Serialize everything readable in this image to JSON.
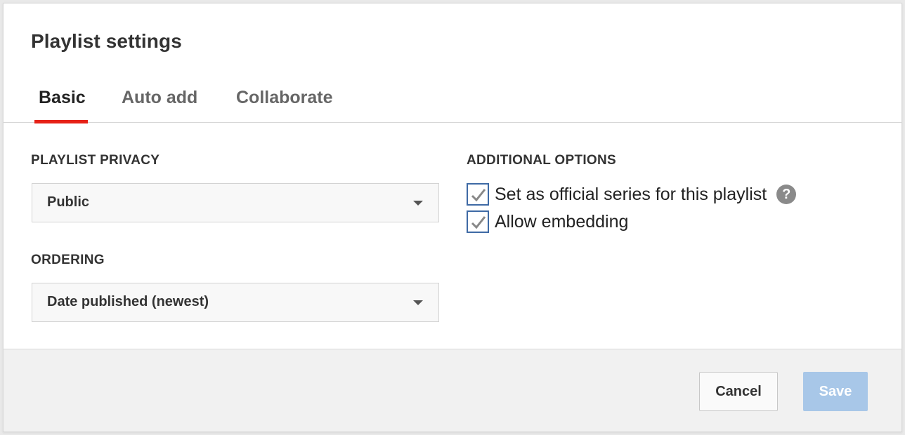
{
  "dialog": {
    "title": "Playlist settings"
  },
  "tabs": [
    {
      "label": "Basic",
      "active": true
    },
    {
      "label": "Auto add",
      "active": false
    },
    {
      "label": "Collaborate",
      "active": false
    }
  ],
  "privacy": {
    "label": "PLAYLIST PRIVACY",
    "selected": "Public"
  },
  "ordering": {
    "label": "ORDERING",
    "selected": "Date published (newest)"
  },
  "options": {
    "label": "ADDITIONAL OPTIONS",
    "items": [
      {
        "label": "Set as official series for this playlist",
        "checked": true,
        "help_icon": "?"
      },
      {
        "label": "Allow embedding",
        "checked": true
      }
    ]
  },
  "footer": {
    "cancel_label": "Cancel",
    "save_label": "Save"
  },
  "colors": {
    "active_tab_underline": "#e62117",
    "checkbox_border": "#3e6aa5",
    "save_button_disabled": "#a8c7e8"
  }
}
